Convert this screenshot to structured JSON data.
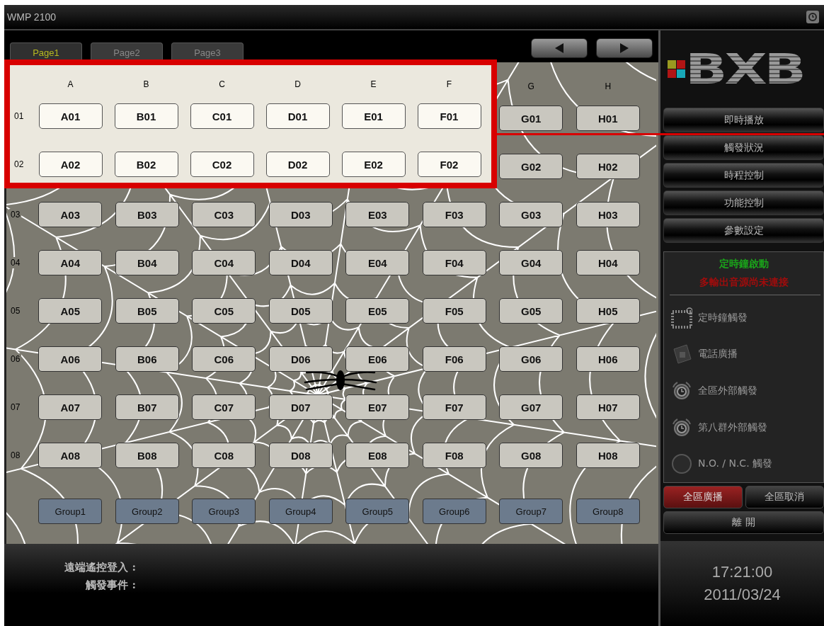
{
  "window": {
    "title": "WMP 2100"
  },
  "tabs": [
    {
      "label": "Page1",
      "selected": true
    },
    {
      "label": "Page2",
      "selected": false
    },
    {
      "label": "Page3",
      "selected": false
    }
  ],
  "grid": {
    "columns": [
      "G",
      "H"
    ],
    "rows": [
      {
        "cells": [
          "G01",
          "H01"
        ]
      },
      {
        "cells": [
          "G02",
          "H02"
        ]
      },
      {
        "label": "03",
        "cells": [
          "A03",
          "B03",
          "C03",
          "D03",
          "E03",
          "F03",
          "G03",
          "H03"
        ]
      },
      {
        "label": "04",
        "cells": [
          "A04",
          "B04",
          "C04",
          "D04",
          "E04",
          "F04",
          "G04",
          "H04"
        ]
      },
      {
        "label": "05",
        "cells": [
          "A05",
          "B05",
          "C05",
          "D05",
          "E05",
          "F05",
          "G05",
          "H05"
        ]
      },
      {
        "label": "06",
        "cells": [
          "A06",
          "B06",
          "C06",
          "D06",
          "E06",
          "F06",
          "G06",
          "H06"
        ]
      },
      {
        "label": "07",
        "cells": [
          "A07",
          "B07",
          "C07",
          "D07",
          "E07",
          "F07",
          "G07",
          "H07"
        ]
      },
      {
        "label": "08",
        "cells": [
          "A08",
          "B08",
          "C08",
          "D08",
          "E08",
          "F08",
          "G08",
          "H08"
        ]
      }
    ],
    "groups": [
      "Group1",
      "Group2",
      "Group3",
      "Group4",
      "Group5",
      "Group6",
      "Group7",
      "Group8"
    ]
  },
  "callout": {
    "columns": [
      "A",
      "B",
      "C",
      "D",
      "E",
      "F"
    ],
    "rows": [
      {
        "label": "01",
        "cells": [
          "A01",
          "B01",
          "C01",
          "D01",
          "E01",
          "F01"
        ]
      },
      {
        "label": "02",
        "cells": [
          "A02",
          "B02",
          "C02",
          "D02",
          "E02",
          "F02"
        ]
      }
    ]
  },
  "status_bar": {
    "labels": [
      "遠端遙控登入 :",
      "觸發事件 :"
    ]
  },
  "sidebar": {
    "logo": "BXB",
    "menu": [
      "即時播放",
      "觸發狀況",
      "時程控制",
      "功能控制",
      "參數設定"
    ],
    "messages": [
      {
        "text": "定時鐘啟動",
        "color": "#1aa31a"
      },
      {
        "text": "多輸出音源尚未連接",
        "color": "#a00c0c"
      }
    ],
    "indicators": [
      {
        "kind": "calendar",
        "label": "定時鐘觸發"
      },
      {
        "kind": "phone",
        "label": "電話廣播"
      },
      {
        "kind": "alarm",
        "label": "全區外部觸發"
      },
      {
        "kind": "alarm",
        "label": "第八群外部觸發"
      },
      {
        "kind": "lamp",
        "label": "N.O. / N.C. 觸發"
      }
    ],
    "actions": [
      {
        "kind": "alert",
        "label": "全區廣播"
      },
      {
        "kind": "normal",
        "label": "全區取消"
      },
      {
        "kind": "wide",
        "label": "離 開"
      }
    ],
    "clock": {
      "time": "17:21:00",
      "date": "2011/03/24"
    }
  }
}
